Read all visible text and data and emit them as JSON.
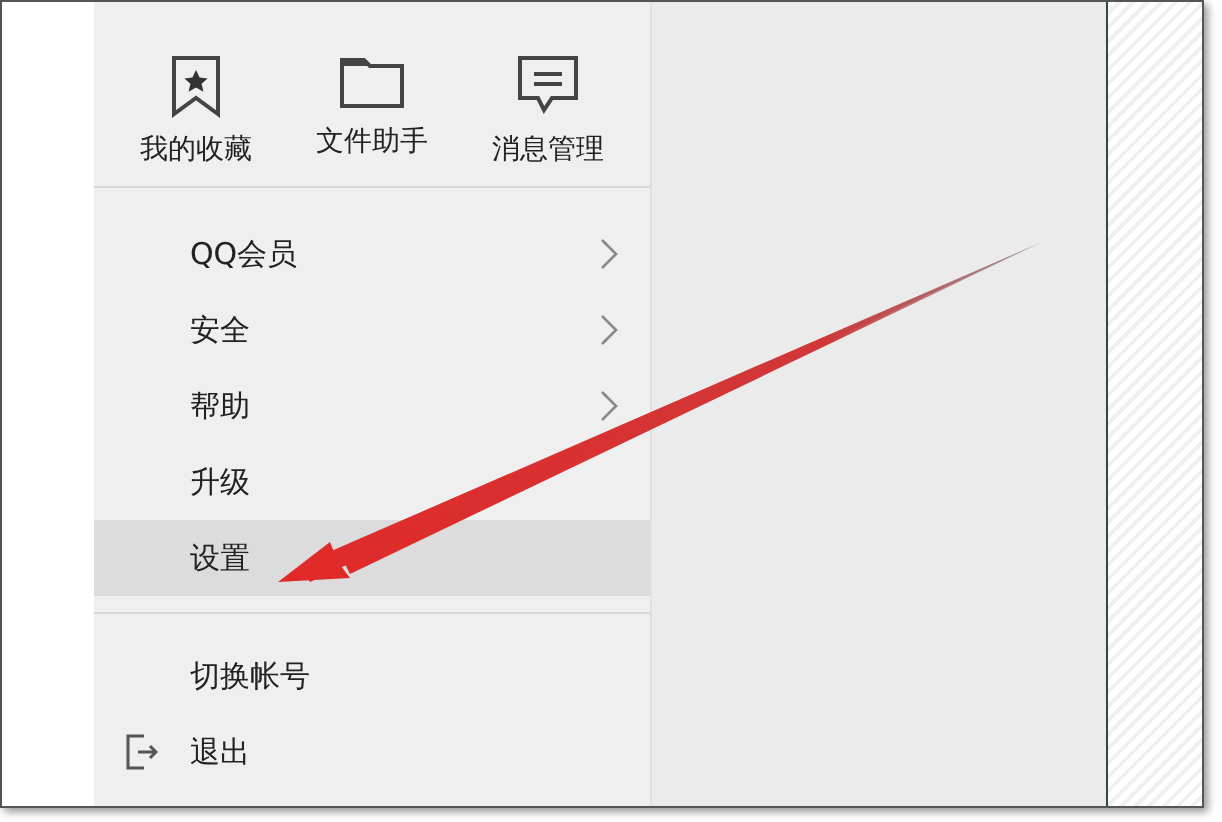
{
  "top_actions": [
    {
      "kind": "favorites",
      "label": "我的收藏"
    },
    {
      "kind": "files",
      "label": "文件助手"
    },
    {
      "kind": "messages",
      "label": "消息管理"
    }
  ],
  "menu_groups": [
    [
      {
        "kind": "item",
        "label": "QQ会员",
        "has_submenu": true,
        "selected": false
      },
      {
        "kind": "item",
        "label": "安全",
        "has_submenu": true,
        "selected": false
      },
      {
        "kind": "item",
        "label": "帮助",
        "has_submenu": true,
        "selected": false
      },
      {
        "kind": "item",
        "label": "升级",
        "has_submenu": false,
        "selected": false
      },
      {
        "kind": "item",
        "label": "设置",
        "has_submenu": false,
        "selected": true
      }
    ],
    [
      {
        "kind": "item",
        "label": "切换帐号",
        "has_submenu": false,
        "selected": false
      },
      {
        "kind": "exit",
        "label": "退出",
        "has_submenu": false,
        "selected": false
      }
    ]
  ]
}
